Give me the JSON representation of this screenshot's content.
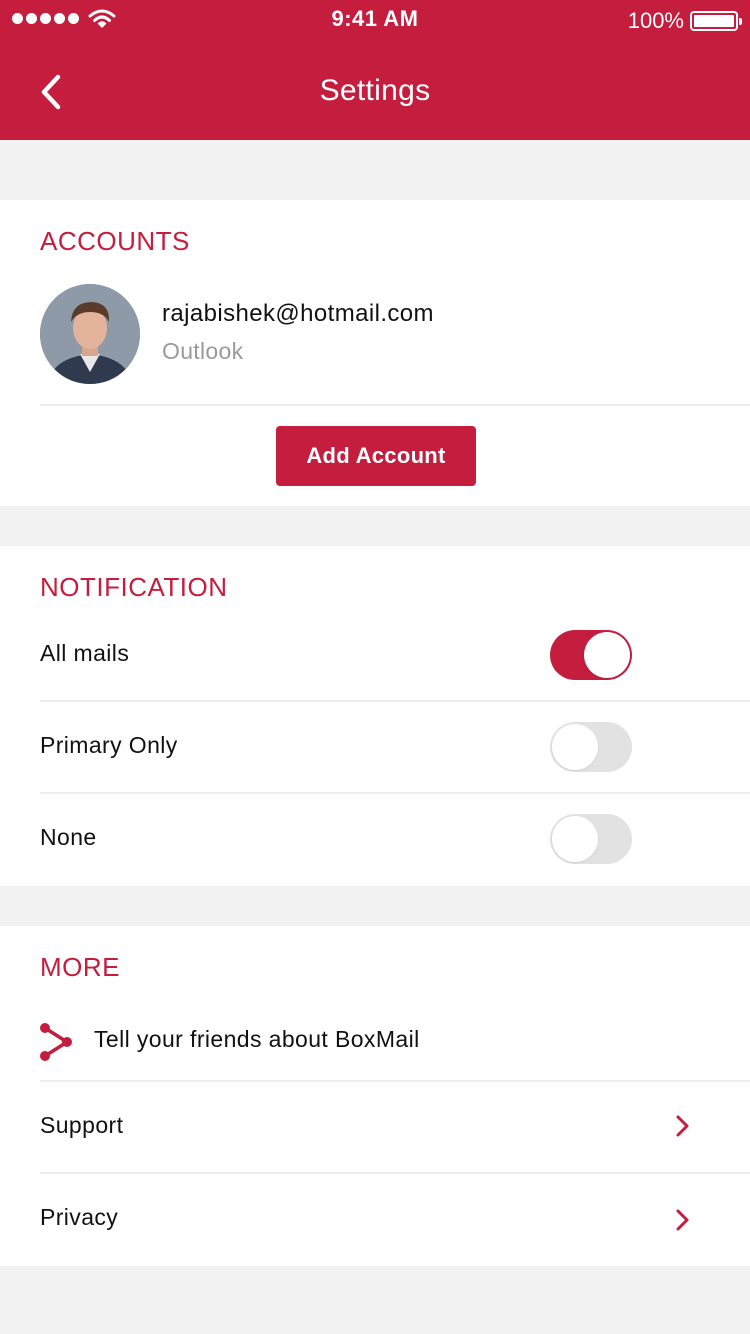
{
  "status_bar": {
    "time": "9:41 AM",
    "battery": "100%",
    "signal_icon": "signal-dots-icon",
    "wifi_icon": "wifi-icon",
    "battery_icon": "battery-icon"
  },
  "header": {
    "title": "Settings",
    "back_icon": "chevron-left-icon"
  },
  "accounts": {
    "title": "ACCOUNTS",
    "items": [
      {
        "email": "rajabishek@hotmail.com",
        "provider": "Outlook"
      }
    ],
    "add_label": "Add Account"
  },
  "notification": {
    "title": "NOTIFICATION",
    "options": [
      {
        "label": "All mails",
        "on": true
      },
      {
        "label": "Primary Only",
        "on": false
      },
      {
        "label": "None",
        "on": false
      }
    ]
  },
  "more": {
    "title": "MORE",
    "share_label": "Tell your friends about BoxMail",
    "support_label": "Support",
    "privacy_label": "Privacy"
  },
  "colors": {
    "accent": "#c51d3e",
    "background": "#f2f2f2",
    "toggle_off": "#e2e2e2"
  }
}
